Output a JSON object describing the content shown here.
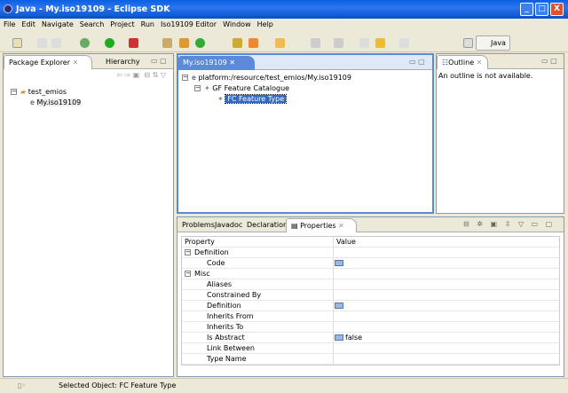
{
  "window": {
    "title": "Java - My.iso19109 - Eclipse SDK",
    "minimize": "_",
    "maximize": "□",
    "close": "X"
  },
  "menu": [
    "File",
    "Edit",
    "Navigate",
    "Search",
    "Project",
    "Run",
    "Iso19109 Editor",
    "Window",
    "Help"
  ],
  "perspective": {
    "label": "Java"
  },
  "package_explorer": {
    "tabs": [
      "Package Explorer",
      "Hierarchy"
    ],
    "tree": [
      {
        "label": "test_emios",
        "children": [
          {
            "label": "My.iso19109"
          }
        ]
      }
    ]
  },
  "editor": {
    "tab": "My.iso19109",
    "tree": {
      "root": "platform:/resource/test_emios/My.iso19109",
      "child": "GF Feature Catalogue",
      "leaf": "FC Feature Type"
    }
  },
  "outline": {
    "tab": "Outline",
    "message": "An outline is not available."
  },
  "bottom": {
    "tabs": [
      "Problems",
      "Javadoc",
      "Declaration",
      "Properties"
    ],
    "columns": [
      "Property",
      "Value"
    ],
    "rows": [
      {
        "label": "Definition",
        "category": true,
        "value": ""
      },
      {
        "label": "Code",
        "category": false,
        "value": "",
        "icon": true
      },
      {
        "label": "Misc",
        "category": true,
        "value": ""
      },
      {
        "label": "Aliases",
        "category": false,
        "value": ""
      },
      {
        "label": "Constrained By",
        "category": false,
        "value": ""
      },
      {
        "label": "Definition",
        "category": false,
        "value": "",
        "icon": true
      },
      {
        "label": "Inherits From",
        "category": false,
        "value": ""
      },
      {
        "label": "Inherits To",
        "category": false,
        "value": ""
      },
      {
        "label": "Is Abstract",
        "category": false,
        "value": "false",
        "icon": true
      },
      {
        "label": "Link Between",
        "category": false,
        "value": ""
      },
      {
        "label": "Type Name",
        "category": false,
        "value": ""
      }
    ]
  },
  "status": {
    "text": "Selected Object: FC Feature Type"
  }
}
